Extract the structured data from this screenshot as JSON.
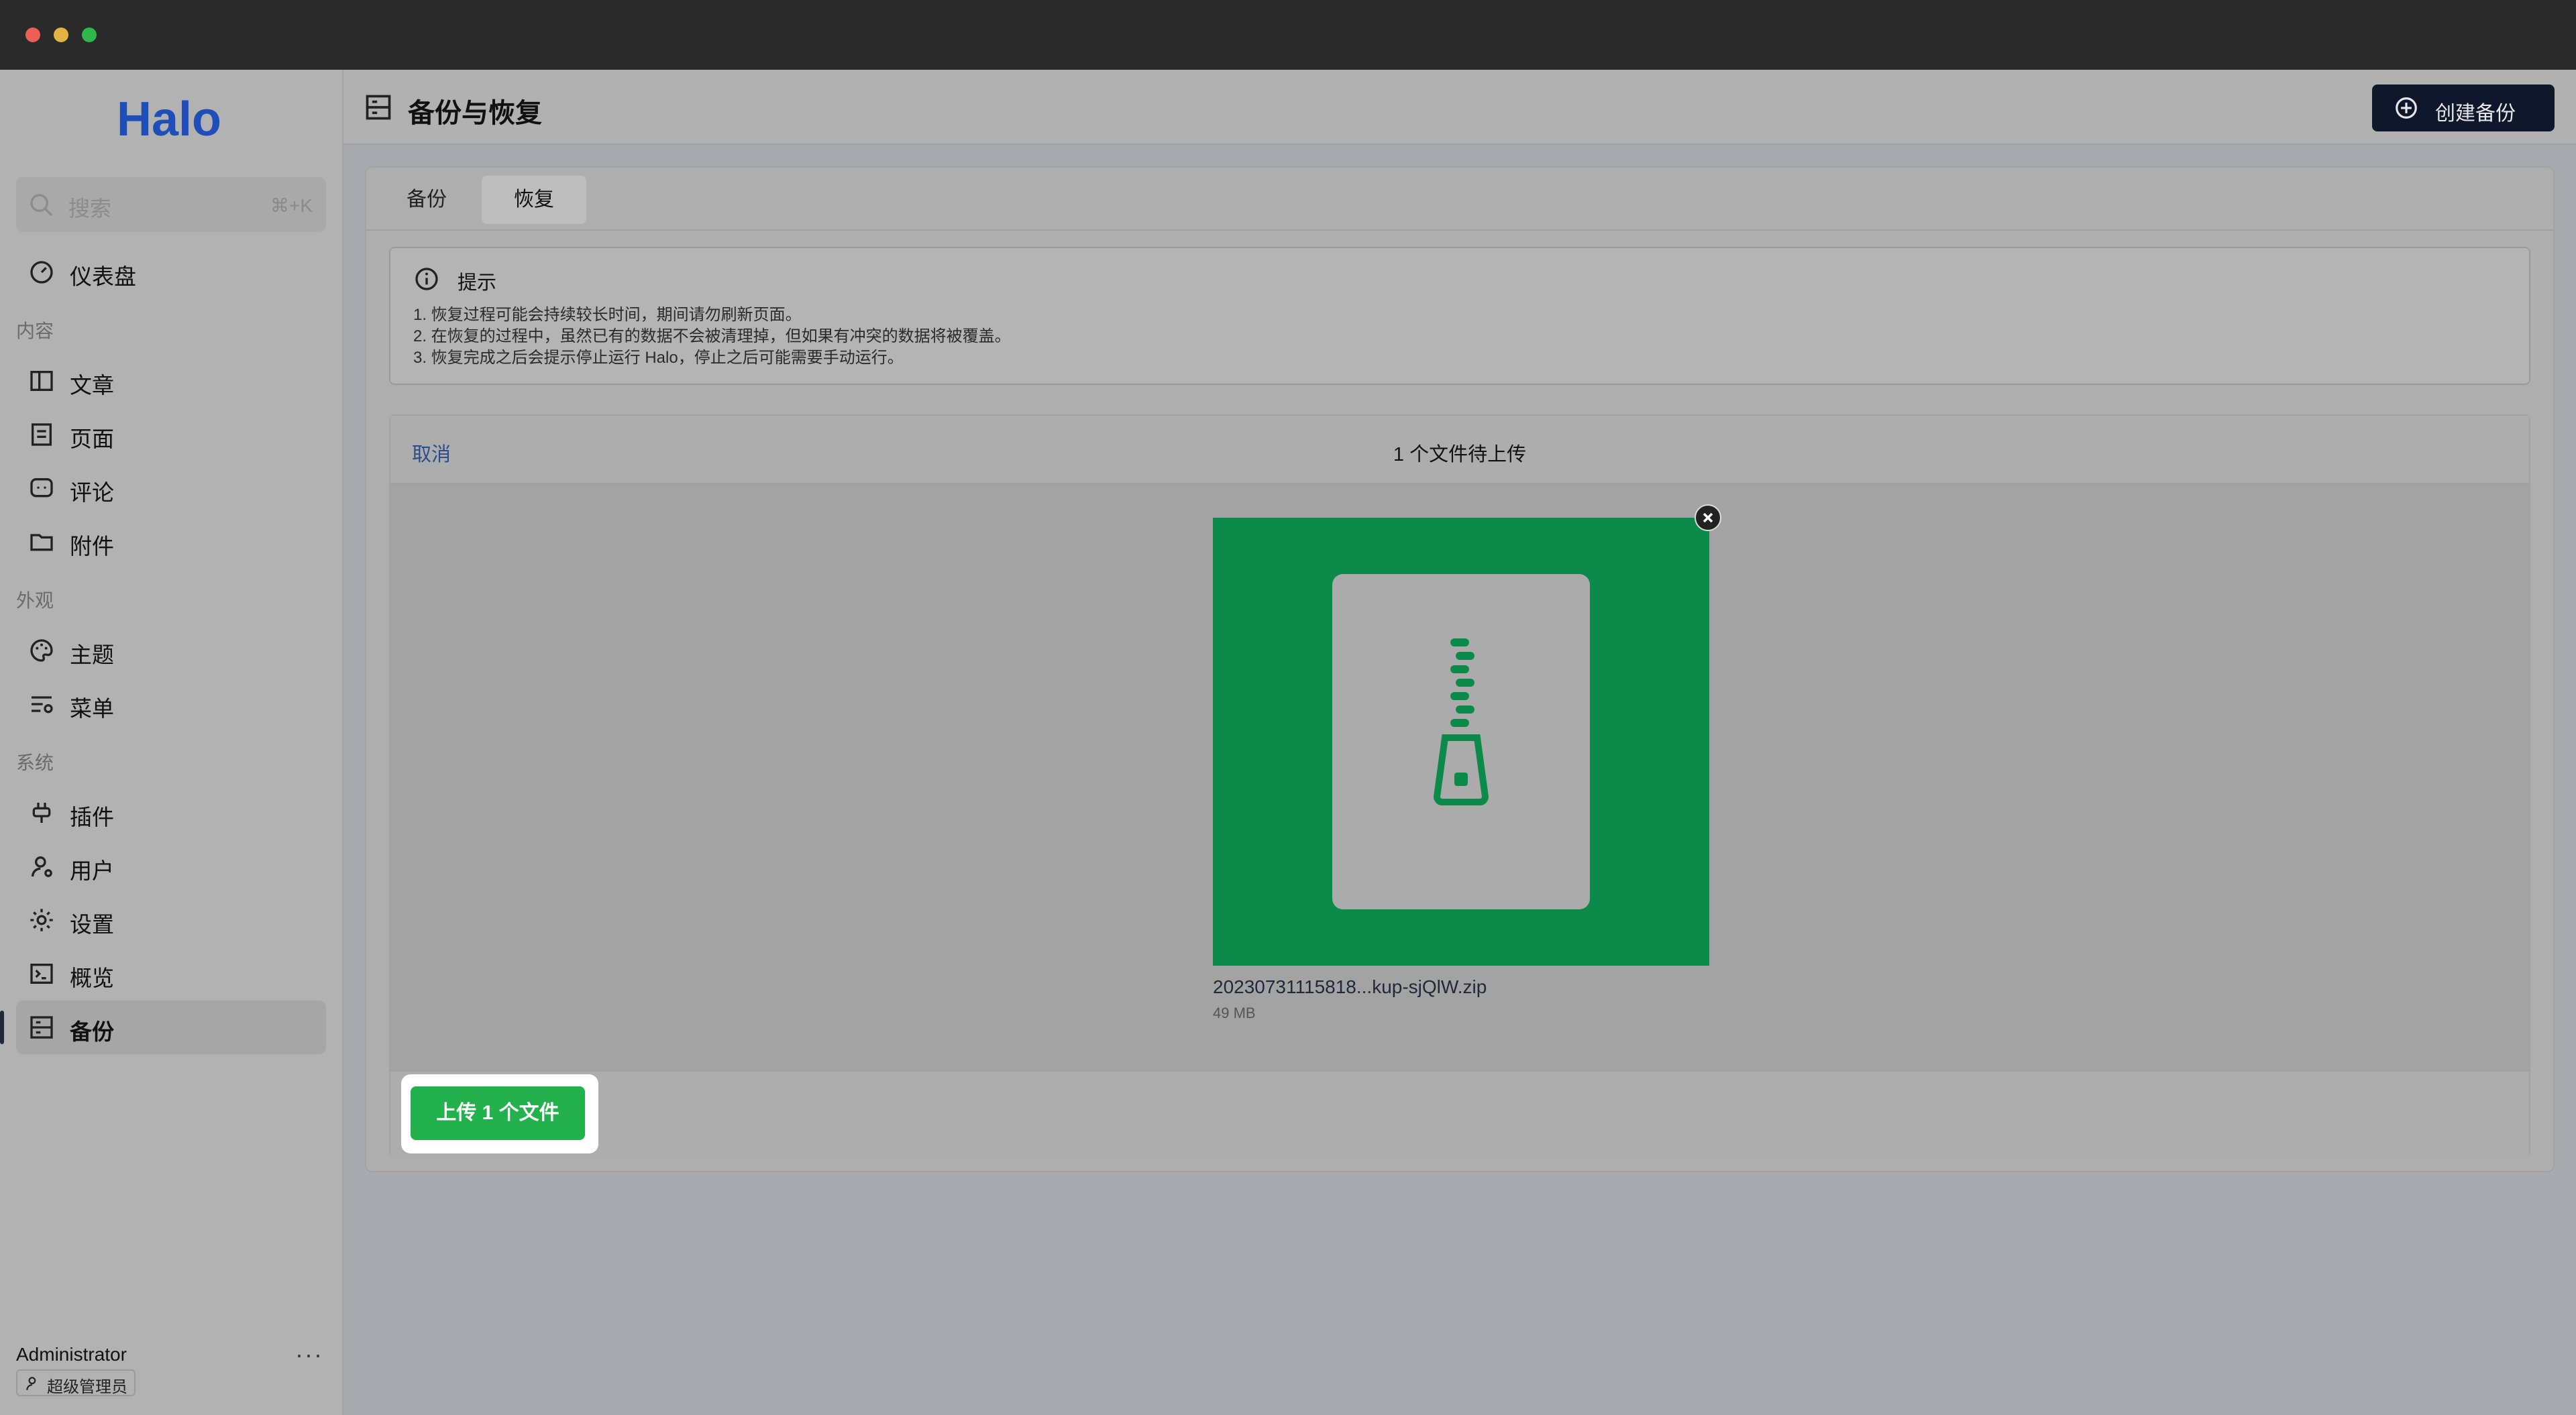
{
  "window": {
    "traffic_lights": [
      "#ec5f57",
      "#e3b341",
      "#2eb84b"
    ]
  },
  "sidebar": {
    "logo": "Halo",
    "search": {
      "placeholder": "搜索",
      "shortcut": "⌘+K"
    },
    "items": [
      {
        "label": "仪表盘",
        "icon": "dashboard-icon"
      },
      {
        "group": "内容"
      },
      {
        "label": "文章",
        "icon": "post-icon"
      },
      {
        "label": "页面",
        "icon": "page-icon"
      },
      {
        "label": "评论",
        "icon": "comment-icon"
      },
      {
        "label": "附件",
        "icon": "folder-icon"
      },
      {
        "group": "外观"
      },
      {
        "label": "主题",
        "icon": "palette-icon"
      },
      {
        "label": "菜单",
        "icon": "menu-icon"
      },
      {
        "group": "系统"
      },
      {
        "label": "插件",
        "icon": "plug-icon"
      },
      {
        "label": "用户",
        "icon": "user-icon"
      },
      {
        "label": "设置",
        "icon": "gear-icon"
      },
      {
        "label": "概览",
        "icon": "terminal-icon"
      },
      {
        "label": "备份",
        "icon": "backup-icon",
        "active": true
      }
    ],
    "user": {
      "name": "Administrator",
      "role": "超级管理员",
      "more": "···"
    }
  },
  "header": {
    "title": "备份与恢复",
    "create_button": "创建备份"
  },
  "tabs": [
    {
      "label": "备份"
    },
    {
      "label": "恢复",
      "active": true
    }
  ],
  "alert": {
    "title": "提示",
    "lines": [
      "1. 恢复过程可能会持续较长时间，期间请勿刷新页面。",
      "2. 在恢复的过程中，虽然已有的数据不会被清理掉，但如果有冲突的数据将被覆盖。",
      "3. 恢复完成之后会提示停止运行 Halo，停止之后可能需要手动运行。"
    ]
  },
  "uploader": {
    "cancel": "取消",
    "pending": "1 个文件待上传",
    "file": {
      "name": "20230731115818...kup-sjQlW.zip",
      "size": "49 MB",
      "thumb_color": "#0b8a49"
    },
    "upload_button": "上传 1 个文件"
  }
}
